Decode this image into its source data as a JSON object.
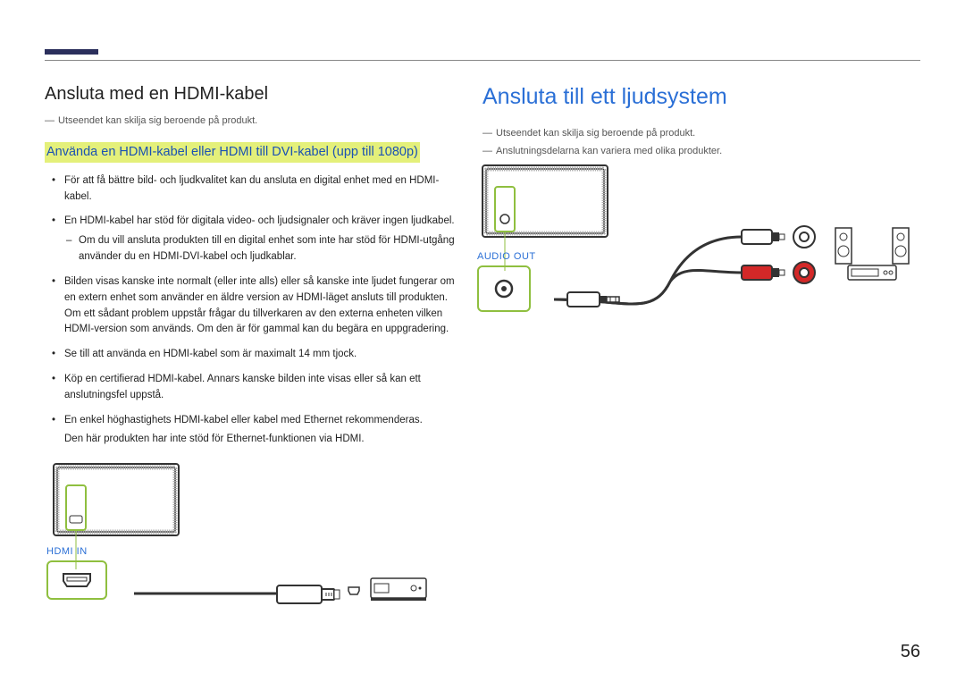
{
  "page_number": "56",
  "left": {
    "heading": "Ansluta med en HDMI-kabel",
    "note1": "Utseendet kan skilja sig beroende på produkt.",
    "subheading_hl": "Använda en HDMI-kabel eller HDMI till DVI-kabel (upp till 1080p)",
    "bullets": [
      "För att få bättre bild- och ljudkvalitet kan du ansluta en digital enhet med en HDMI-kabel.",
      "En HDMI-kabel har stöd för digitala video- och ljudsignaler och kräver ingen ljudkabel.",
      "Bilden visas kanske inte normalt (eller inte alls) eller så kanske inte ljudet fungerar om en extern enhet som använder en äldre version av HDMI-läget ansluts till produkten. Om ett sådant problem uppstår frågar du tillverkaren av den externa enheten vilken HDMI-version som används. Om den är för gammal kan du begära en uppgradering.",
      "Se till att använda en HDMI-kabel som är maximalt 14 mm tjock.",
      "Köp en certifierad HDMI-kabel. Annars kanske bilden inte visas eller så kan ett anslutningsfel uppstå.",
      "En enkel höghastighets HDMI-kabel eller kabel med Ethernet rekommenderas."
    ],
    "sub_bullet": "Om du vill ansluta produkten till en digital enhet som inte har stöd för HDMI-utgång använder du en HDMI-DVI-kabel och ljudkablar.",
    "after_last": "Den här produkten har inte stöd för Ethernet-funktionen via HDMI.",
    "port_label": "HDMI IN"
  },
  "right": {
    "heading": "Ansluta till ett ljudsystem",
    "note1": "Utseendet kan skilja sig beroende på produkt.",
    "note2": "Anslutningsdelarna kan variera med olika produkter.",
    "port_label": "AUDIO OUT"
  }
}
